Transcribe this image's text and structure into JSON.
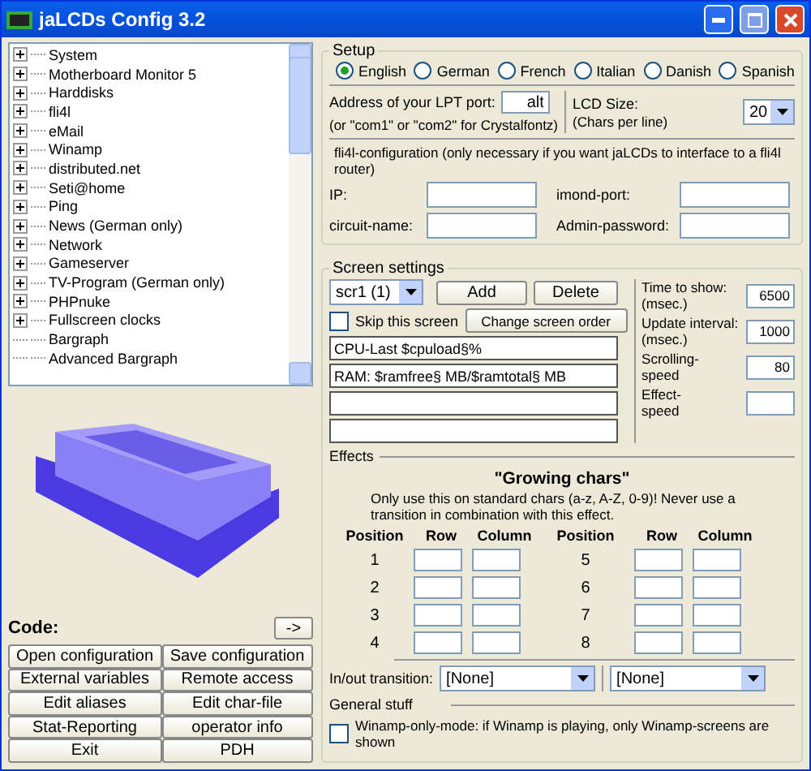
{
  "window": {
    "title": "jaLCDs Config 3.2"
  },
  "tree": {
    "items": [
      {
        "label": "System",
        "expandable": true
      },
      {
        "label": "Motherboard Monitor 5",
        "expandable": true
      },
      {
        "label": "Harddisks",
        "expandable": true
      },
      {
        "label": "fli4l",
        "expandable": true
      },
      {
        "label": "eMail",
        "expandable": true
      },
      {
        "label": "Winamp",
        "expandable": true
      },
      {
        "label": "distributed.net",
        "expandable": true
      },
      {
        "label": "Seti@home",
        "expandable": true
      },
      {
        "label": "Ping",
        "expandable": true
      },
      {
        "label": "News (German only)",
        "expandable": true
      },
      {
        "label": "Network",
        "expandable": true
      },
      {
        "label": "Gameserver",
        "expandable": true
      },
      {
        "label": "TV-Program (German only)",
        "expandable": true
      },
      {
        "label": "PHPnuke",
        "expandable": true
      },
      {
        "label": "Fullscreen clocks",
        "expandable": true
      },
      {
        "label": "Bargraph",
        "expandable": false
      },
      {
        "label": "Advanced Bargraph",
        "expandable": false
      }
    ]
  },
  "code": {
    "label": "Code:",
    "button": "->"
  },
  "buttons": [
    "Open configuration",
    "Save configuration",
    "External variables",
    "Remote access",
    "Edit aliases",
    "Edit char-file",
    "Stat-Reporting",
    "operator info",
    "Exit",
    "PDH"
  ],
  "setup": {
    "title": "Setup",
    "languages": [
      {
        "label": "English",
        "selected": true
      },
      {
        "label": "German",
        "selected": false
      },
      {
        "label": "French",
        "selected": false
      },
      {
        "label": "Italian",
        "selected": false
      },
      {
        "label": "Danish",
        "selected": false
      },
      {
        "label": "Spanish",
        "selected": false
      }
    ],
    "lpt_label": "Address of your LPT port:",
    "lpt_hint": "(or \"com1\" or \"com2\" for Crystalfontz)",
    "lpt_value": "alt",
    "lcd_label": "LCD Size:",
    "lcd_hint": "(Chars per line)",
    "lcd_size": "20",
    "fli4l_heading": "fli4l-configuration (only necessary if you want jaLCDs to interface to a fli4l router)",
    "fields": [
      {
        "label": "IP:"
      },
      {
        "label": "imond-port:"
      },
      {
        "label": "circuit-name:"
      },
      {
        "label": "Admin-password:"
      }
    ]
  },
  "screen": {
    "title": "Screen settings",
    "screen_select": "scr1 (1)",
    "add": "Add",
    "delete": "Delete",
    "skip": {
      "label": "Skip this screen",
      "checked": false
    },
    "change_order": "Change screen order",
    "lines": [
      {
        "kind": "text",
        "value": "CPU-Last $cpuload§%"
      },
      {
        "kind": "text",
        "value": "RAM: $ramfree§ MB/$ramtotal§ MB"
      },
      {
        "kind": "blank"
      },
      {
        "kind": "blank"
      }
    ],
    "timings": [
      {
        "label": "Time to show:",
        "hint": "(msec.)",
        "value": "6500"
      },
      {
        "label": "Update interval:",
        "hint": "(msec.)",
        "value": "1000"
      },
      {
        "label": "Scrolling-",
        "hint": "speed",
        "value": "80"
      },
      {
        "label": "Effect-",
        "hint": "speed"
      }
    ],
    "effects": {
      "title": "Effects",
      "heading": "\"Growing chars\"",
      "note": "Only use this on standard chars (a-z, A-Z, 0-9)! Never use a transition in combination with this effect.",
      "columns": [
        "Position",
        "Row",
        "Column",
        "Position",
        "Row",
        "Column"
      ],
      "positions": [
        "1",
        "2",
        "3",
        "4",
        "5",
        "6",
        "7",
        "8"
      ]
    },
    "transition": {
      "label": "In/out transition:",
      "values": [
        "[None]",
        "[None]"
      ]
    },
    "general": {
      "title": "General stuff",
      "winamp": {
        "label": "Winamp-only-mode: if Winamp is playing, only Winamp-screens are shown",
        "checked": false
      }
    }
  }
}
